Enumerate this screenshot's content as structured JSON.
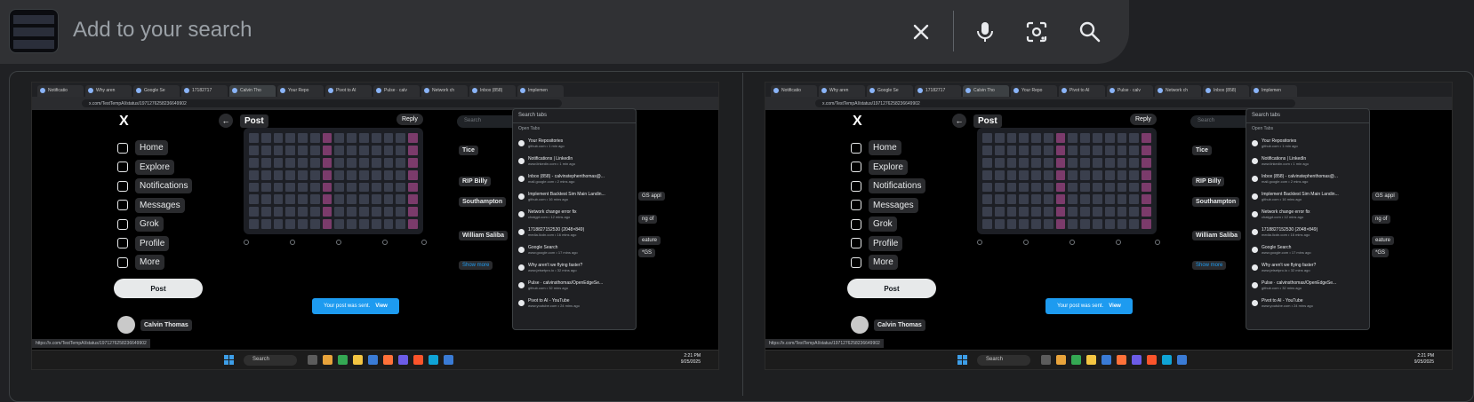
{
  "search": {
    "placeholder": "Add to your search",
    "clear_icon": "close-icon",
    "voice_icon": "mic-icon",
    "lens_icon": "camera-lens-icon",
    "search_icon": "search-icon"
  },
  "results": [
    {
      "tabs": [
        "Notificatio",
        "Why aren",
        "Google Se",
        "17182717",
        "Calvin Tho",
        "Your Repo",
        "Pivot to AI",
        "Pulse · calv",
        "Network ch",
        "Inbox (858)",
        "Implemen"
      ],
      "url": "x.com/TestTempAI/status/1971276258236649902",
      "nav": [
        "Home",
        "Explore",
        "Notifications",
        "Messages",
        "Grok",
        "Profile",
        "More"
      ],
      "post_button": "Post",
      "profile_name": "Calvin Thomas",
      "post_header": "Post",
      "reply_button": "Reply",
      "toast_text": "Your post was sent.",
      "toast_link": "View",
      "search_placeholder": "Search",
      "trends": [
        "Tice",
        "RIP Billy",
        "Southampton",
        "William Saliba"
      ],
      "show_more": "Show more",
      "tabsearch_placeholder": "Search tabs",
      "open_tabs_label": "Open Tabs",
      "open_tabs": [
        {
          "title": "Your Repositories",
          "url": "github.com • 1 min ago"
        },
        {
          "title": "Notifications | LinkedIn",
          "url": "www.linkedin.com • 1 min ago"
        },
        {
          "title": "Inbox (858) - calvinstephenthomas@...",
          "url": "mail.google.com • 2 mins ago"
        },
        {
          "title": "Implement Backtest Sim Main Landin...",
          "url": "github.com • 16 mins ago"
        },
        {
          "title": "Network change error fix",
          "url": "chatgpt.com • 12 mins ago"
        },
        {
          "title": "1718827152530 (2048×849)",
          "url": "media.licdn.com • 16 mins ago"
        },
        {
          "title": "Google Search",
          "url": "www.google.com • 17 mins ago"
        },
        {
          "title": "Why aren't we flying faster?",
          "url": "www.jetsetpro.io • 32 mins ago"
        },
        {
          "title": "Pulse · calvinsthomas/OpenEdgeSe...",
          "url": "github.com • 32 mins ago"
        },
        {
          "title": "Pivot to AI - YouTube",
          "url": "www.youtube.com • 24 mins ago"
        }
      ],
      "side_chips": [
        "GS appl",
        "ng of",
        "eature",
        "*GS"
      ],
      "taskbar_search": "Search",
      "clock_time": "2:21 PM",
      "clock_date": "9/25/2025",
      "status_url": "https://x.com/TestTempAI/status/1971276258236649902"
    },
    {
      "tabs": [
        "Notificatio",
        "Why aren",
        "Google Se",
        "17182717",
        "Calvin Tho",
        "Your Repo",
        "Pivot to AI",
        "Pulse · calv",
        "Network ch",
        "Inbox (858)",
        "Implemen"
      ],
      "url": "x.com/TestTempAI/status/1971276258236649902",
      "nav": [
        "Home",
        "Explore",
        "Notifications",
        "Messages",
        "Grok",
        "Profile",
        "More"
      ],
      "post_button": "Post",
      "profile_name": "Calvin Thomas",
      "post_header": "Post",
      "reply_button": "Reply",
      "toast_text": "Your post was sent.",
      "toast_link": "View",
      "search_placeholder": "Search",
      "trends": [
        "Tice",
        "RIP Billy",
        "Southampton",
        "William Saliba"
      ],
      "show_more": "Show more",
      "tabsearch_placeholder": "Search tabs",
      "open_tabs_label": "Open Tabs",
      "open_tabs": [
        {
          "title": "Your Repositories",
          "url": "github.com • 1 min ago"
        },
        {
          "title": "Notifications | LinkedIn",
          "url": "www.linkedin.com • 1 min ago"
        },
        {
          "title": "Inbox (858) - calvinstephenthomas@...",
          "url": "mail.google.com • 2 mins ago"
        },
        {
          "title": "Implement Backtest Sim Main Landin...",
          "url": "github.com • 16 mins ago"
        },
        {
          "title": "Network change error fix",
          "url": "chatgpt.com • 12 mins ago"
        },
        {
          "title": "1718827152530 (2048×849)",
          "url": "media.licdn.com • 16 mins ago"
        },
        {
          "title": "Google Search",
          "url": "www.google.com • 17 mins ago"
        },
        {
          "title": "Why aren't we flying faster?",
          "url": "www.jetsetpro.io • 32 mins ago"
        },
        {
          "title": "Pulse · calvinsthomas/OpenEdgeSe...",
          "url": "github.com • 32 mins ago"
        },
        {
          "title": "Pivot to AI - YouTube",
          "url": "www.youtube.com • 24 mins ago"
        }
      ],
      "side_chips": [
        "GS appl",
        "ng of",
        "eature",
        "*GS"
      ],
      "taskbar_search": "Search",
      "clock_time": "2:21 PM",
      "clock_date": "9/25/2025",
      "status_url": "https://x.com/TestTempAI/status/1971276258236649902"
    }
  ]
}
